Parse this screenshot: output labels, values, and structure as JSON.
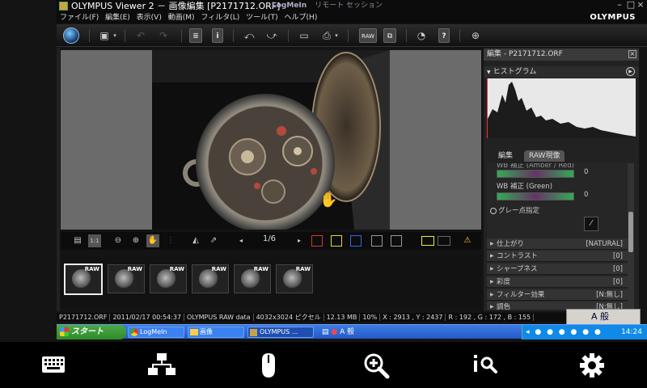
{
  "window": {
    "title": "OLYMPUS Viewer 2 － 画像編集 [P2171712.ORF]",
    "logmein_label": "LogMeIn",
    "logmein_session": "リモート セッション"
  },
  "menu": {
    "items": [
      "ファイル(F)",
      "編集(E)",
      "表示(V)",
      "動画(M)",
      "フィルタ(L)",
      "ツール(T)",
      "ヘルプ(H)"
    ],
    "brand": "OLYMPUS"
  },
  "toolbar": {
    "raw_label": "RAW",
    "info_label": "i",
    "help_label": "?"
  },
  "viewer": {
    "page_indicator": "1/6",
    "zoom_box": "1:1"
  },
  "filmstrip": {
    "thumbs": [
      {
        "badge": "RAW"
      },
      {
        "badge": "RAW"
      },
      {
        "badge": "RAW"
      },
      {
        "badge": "RAW"
      },
      {
        "badge": "RAW"
      },
      {
        "badge": "RAW"
      }
    ]
  },
  "panel": {
    "header": "編集 - P2171712.ORF",
    "histogram_label": "ヒストグラム",
    "tabs": [
      "編集",
      "RAW現像"
    ],
    "wb_top_label": "WB 補正 (Amber / Red)",
    "wb_top_value": "0",
    "wb_green_label": "WB 補正 (Green)",
    "wb_green_value": "0",
    "gray_point_label": "グレー点指定",
    "rows": [
      {
        "label": "仕上がり",
        "value": "[NATURAL]"
      },
      {
        "label": "コントラスト",
        "value": "[0]"
      },
      {
        "label": "シャープネス",
        "value": "[0]"
      },
      {
        "label": "彩度",
        "value": "[0]"
      },
      {
        "label": "フィルター効果",
        "value": "[N:無し]"
      },
      {
        "label": "調色",
        "value": "[N:無し]"
      }
    ]
  },
  "status": {
    "filename": "P2171712.ORF",
    "datetime": "2011/02/17 00:54:37",
    "format": "OLYMPUS RAW data",
    "dimensions": "4032x3024 ピクセル",
    "size": "12.13 MB",
    "zoom": "10%",
    "coords": "X : 2913 , Y : 2437",
    "rgb": "R : 192 , G : 172 , B : 155"
  },
  "ime": {
    "label": "A 般"
  },
  "taskbar": {
    "start": "スタート",
    "items": [
      {
        "label": "LogMeIn"
      },
      {
        "label": "画像"
      },
      {
        "label": "OLYMPUS ..."
      }
    ],
    "ime_mode": "A 般",
    "clock": "14:24"
  },
  "bottom_nav": [
    "keyboard-icon",
    "network-icon",
    "mouse-icon",
    "zoom-in-icon",
    "info-search-icon",
    "gear-icon"
  ],
  "colors": {
    "accent_histogram": "#e33",
    "taskbar_blue": "#2458c8",
    "start_green": "#2f8b2a"
  }
}
